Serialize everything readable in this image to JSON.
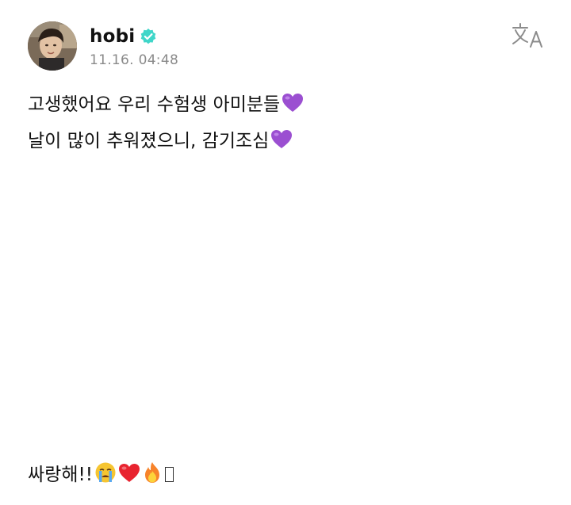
{
  "post": {
    "author": {
      "username": "hobi",
      "verified": true,
      "verified_color": "#3fd6c9"
    },
    "timestamp": "11.16. 04:48",
    "translate_icon": "translate-icon",
    "lines": [
      "고생했어요 우리 수험생 아미분들",
      "날이 많이 추워졌으니, 감기조심"
    ],
    "footer_line": "싸랑해!!",
    "emojis": {
      "line1": "purple-heart",
      "line2": "purple-heart",
      "footer": [
        "crying-face",
        "red-heart",
        "fire",
        "missing-glyph"
      ]
    }
  }
}
